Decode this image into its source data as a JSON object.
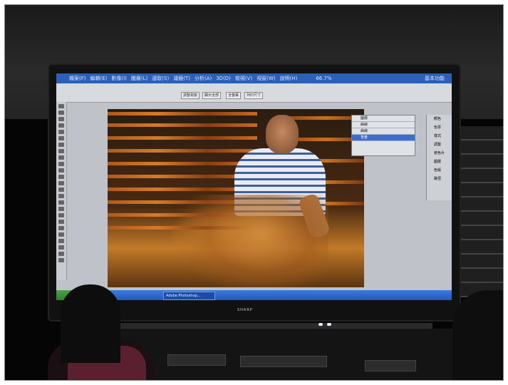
{
  "scene": {
    "tv_brand": "SHARP"
  },
  "app": {
    "menu_items": [
      "檔案(F)",
      "編輯(E)",
      "影像(I)",
      "圖層(L)",
      "選取(S)",
      "濾鏡(T)",
      "分析(A)",
      "3D(D)",
      "檢視(V)",
      "視窗(W)",
      "說明(H)"
    ],
    "workspace_label": "基本功能",
    "options_buttons": [
      "調整視窗",
      "顯示全部",
      "全螢幕",
      "列印尺寸"
    ],
    "zoom_label": "66.7%",
    "layers_panel": {
      "rows": [
        "圖層",
        "曲線",
        "曲線",
        "背景"
      ]
    },
    "side_panel_items": [
      "顏色",
      "色票",
      "樣式",
      "調整",
      "遮色片",
      "圖層",
      "色版",
      "路徑"
    ],
    "taskbar": {
      "start_label": "開始",
      "task_label": "Adobe Photoshop..."
    }
  },
  "colors": {
    "taskbar_blue": "#2458b8",
    "menu_blue": "#2b5fb8",
    "photo_orange": "#c27a28"
  }
}
